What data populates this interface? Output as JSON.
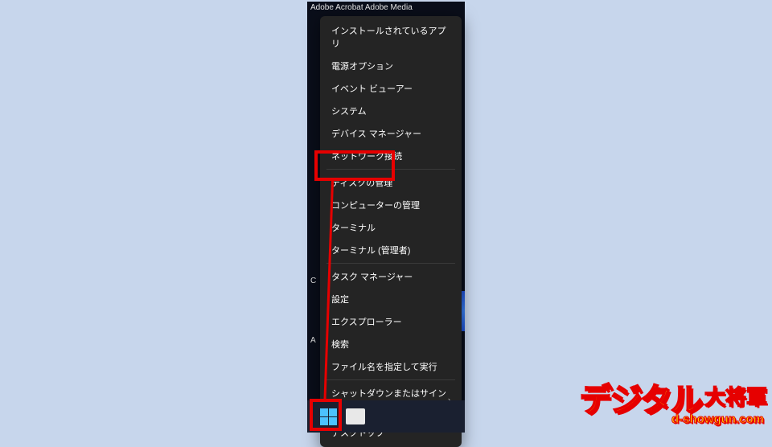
{
  "desktop_icons_text": "Adobe Acrobat    Adobe Media",
  "left_cue1": "C",
  "left_cue2": "A",
  "menu": {
    "items": [
      {
        "label": "インストールされているアプリ",
        "arrow": false
      },
      {
        "label": "電源オプション",
        "arrow": false
      },
      {
        "label": "イベント ビューアー",
        "arrow": false
      },
      {
        "label": "システム",
        "arrow": false
      },
      {
        "label": "デバイス マネージャー",
        "arrow": false
      },
      {
        "label": "ネットワーク接続",
        "arrow": false
      },
      {
        "label": "ディスクの管理",
        "arrow": false
      },
      {
        "label": "コンピューターの管理",
        "arrow": false
      },
      {
        "label": "ターミナル",
        "arrow": false
      },
      {
        "label": "ターミナル (管理者)",
        "arrow": false
      },
      {
        "label": "タスク マネージャー",
        "arrow": false
      },
      {
        "label": "設定",
        "arrow": false
      },
      {
        "label": "エクスプローラー",
        "arrow": false
      },
      {
        "label": "検索",
        "arrow": false
      },
      {
        "label": "ファイル名を指定して実行",
        "arrow": false
      },
      {
        "label": "シャットダウンまたはサインアウト",
        "arrow": true
      },
      {
        "label": "デスクトップ",
        "arrow": false
      }
    ],
    "separators_after": [
      5,
      9,
      14,
      15
    ]
  },
  "watermark": {
    "main": "デジタル",
    "sub": "大将軍",
    "url": "d-showgun.com"
  }
}
